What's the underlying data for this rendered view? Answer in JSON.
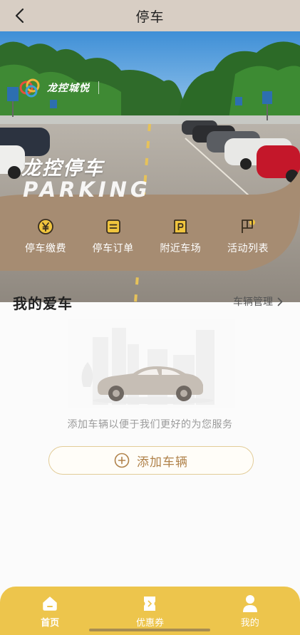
{
  "header": {
    "title": "停车"
  },
  "hero": {
    "logo_text": "龙控城悦",
    "brand_title": "龙控停车",
    "brand_subtitle": "PARKING"
  },
  "quick_menu": {
    "items": [
      {
        "label": "停车缴费",
        "icon": "yen-icon"
      },
      {
        "label": "停车订单",
        "icon": "order-icon"
      },
      {
        "label": "附近车场",
        "icon": "parking-lot-icon"
      },
      {
        "label": "活动列表",
        "icon": "flag-icon"
      }
    ]
  },
  "my_car": {
    "title": "我的爱车",
    "manage_label": "车辆管理",
    "hint": "添加车辆以便于我们更好的为您服务",
    "add_label": "添加车辆"
  },
  "tabbar": {
    "items": [
      {
        "label": "首页",
        "icon": "home-icon",
        "active": true
      },
      {
        "label": "优惠券",
        "icon": "coupon-icon",
        "active": false
      },
      {
        "label": "我的",
        "icon": "user-icon",
        "active": false
      }
    ]
  },
  "colors": {
    "accent": "#edc54c",
    "brown": "#a68c72",
    "topbar": "#d8cec4",
    "button_text": "#b0824a"
  }
}
